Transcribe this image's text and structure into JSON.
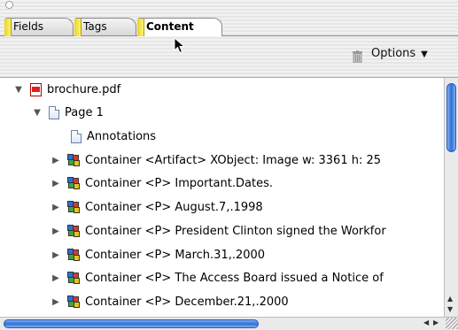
{
  "tabs": [
    {
      "label": "Fields",
      "active": false
    },
    {
      "label": "Tags",
      "active": false
    },
    {
      "label": "Content",
      "active": true
    }
  ],
  "toolbar": {
    "trash_icon": "trash-icon",
    "options_label": "Options",
    "options_caret": "▼"
  },
  "tree": {
    "expanded_glyph": "▼",
    "collapsed_glyph": "▶",
    "root": {
      "label": "brochure.pdf",
      "icon": "pdf-file-icon",
      "expanded": true
    },
    "page": {
      "label": "Page 1",
      "icon": "page-icon",
      "expanded": true
    },
    "annotations": {
      "label": "Annotations",
      "icon": "page-icon"
    },
    "containers": [
      "Container <Artifact> XObject:  Image  w: 3361 h: 25",
      "Container <P> Important.Dates.",
      "Container <P> August.7,.1998",
      "Container <P> President Clinton signed the Workfor",
      "Container <P> March.31,.2000",
      "Container <P> The Access Board issued a Notice of",
      "Container <P> December.21,.2000"
    ]
  },
  "colors": {
    "scroll_thumb": "#2f6fd8",
    "tab_marker": "#e8d420",
    "pdf_icon": "#e02020"
  }
}
